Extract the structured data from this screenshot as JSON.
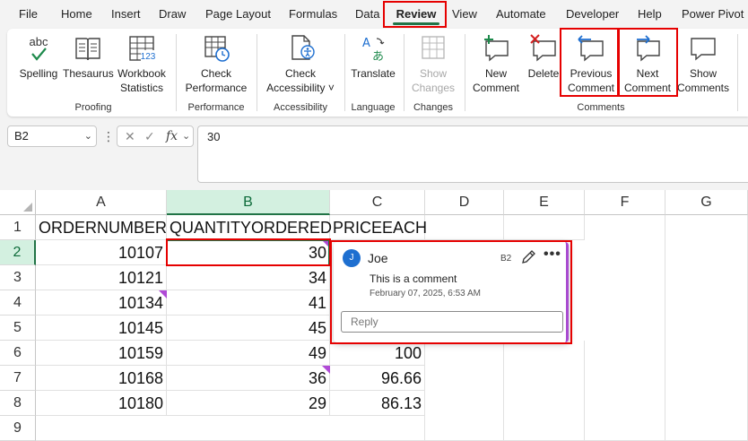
{
  "menu": {
    "tabs": [
      "File",
      "Home",
      "Insert",
      "Draw",
      "Page Layout",
      "Formulas",
      "Data",
      "Review",
      "View",
      "Automate",
      "Developer",
      "Help",
      "Power Pivot"
    ],
    "active_tab": "Review"
  },
  "ribbon": {
    "spelling": "Spelling",
    "spelling_glyph": "abc",
    "thesaurus": "Thesaurus",
    "workbook_stats_l1": "Workbook",
    "workbook_stats_l2": "Statistics",
    "check_perf_l1": "Check",
    "check_perf_l2": "Performance",
    "check_access_l1": "Check",
    "check_access_l2": "Accessibility ˅",
    "translate": "Translate",
    "show_changes_l1": "Show",
    "show_changes_l2": "Changes",
    "new_comment_l1": "New",
    "new_comment_l2": "Comment",
    "delete": "Delete",
    "prev_comment_l1": "Previous",
    "prev_comment_l2": "Comment",
    "next_comment_l1": "Next",
    "next_comment_l2": "Comment",
    "show_comments_l1": "Show",
    "show_comments_l2": "Comments",
    "groups": {
      "proofing": "Proofing",
      "performance": "Performance",
      "accessibility": "Accessibility",
      "language": "Language",
      "changes": "Changes",
      "comments": "Comments"
    }
  },
  "formula_bar": {
    "name_box": "B2",
    "chevron": "⌄",
    "more_dots": "⋮",
    "cancel": "✕",
    "enter": "✓",
    "fx": "fx",
    "value": "30"
  },
  "sheet": {
    "columns": [
      "A",
      "B",
      "C",
      "D",
      "E",
      "F",
      "G"
    ],
    "selected_column": "B",
    "rows": [
      "1",
      "2",
      "3",
      "4",
      "5",
      "6",
      "7",
      "8",
      "9"
    ],
    "selected_row": "2",
    "headers": [
      "ORDERNUMBER",
      "QUANTITYORDERED",
      "PRICEEACH"
    ],
    "data": [
      [
        "10107",
        "30",
        ""
      ],
      [
        "10121",
        "34",
        ""
      ],
      [
        "10134",
        "41",
        ""
      ],
      [
        "10145",
        "45",
        ""
      ],
      [
        "10159",
        "49",
        "100"
      ],
      [
        "10168",
        "36",
        "96.66"
      ],
      [
        "10180",
        "29",
        "86.13"
      ]
    ],
    "comment_mark_color": "#b04ad6",
    "selection_color": "#217346"
  },
  "comment": {
    "initial": "J",
    "author": "Joe",
    "cell_ref": "B2",
    "more": "•••",
    "text": "This is a comment",
    "date": "February 07, 2025, 6:53 AM",
    "reply_placeholder": "Reply"
  }
}
